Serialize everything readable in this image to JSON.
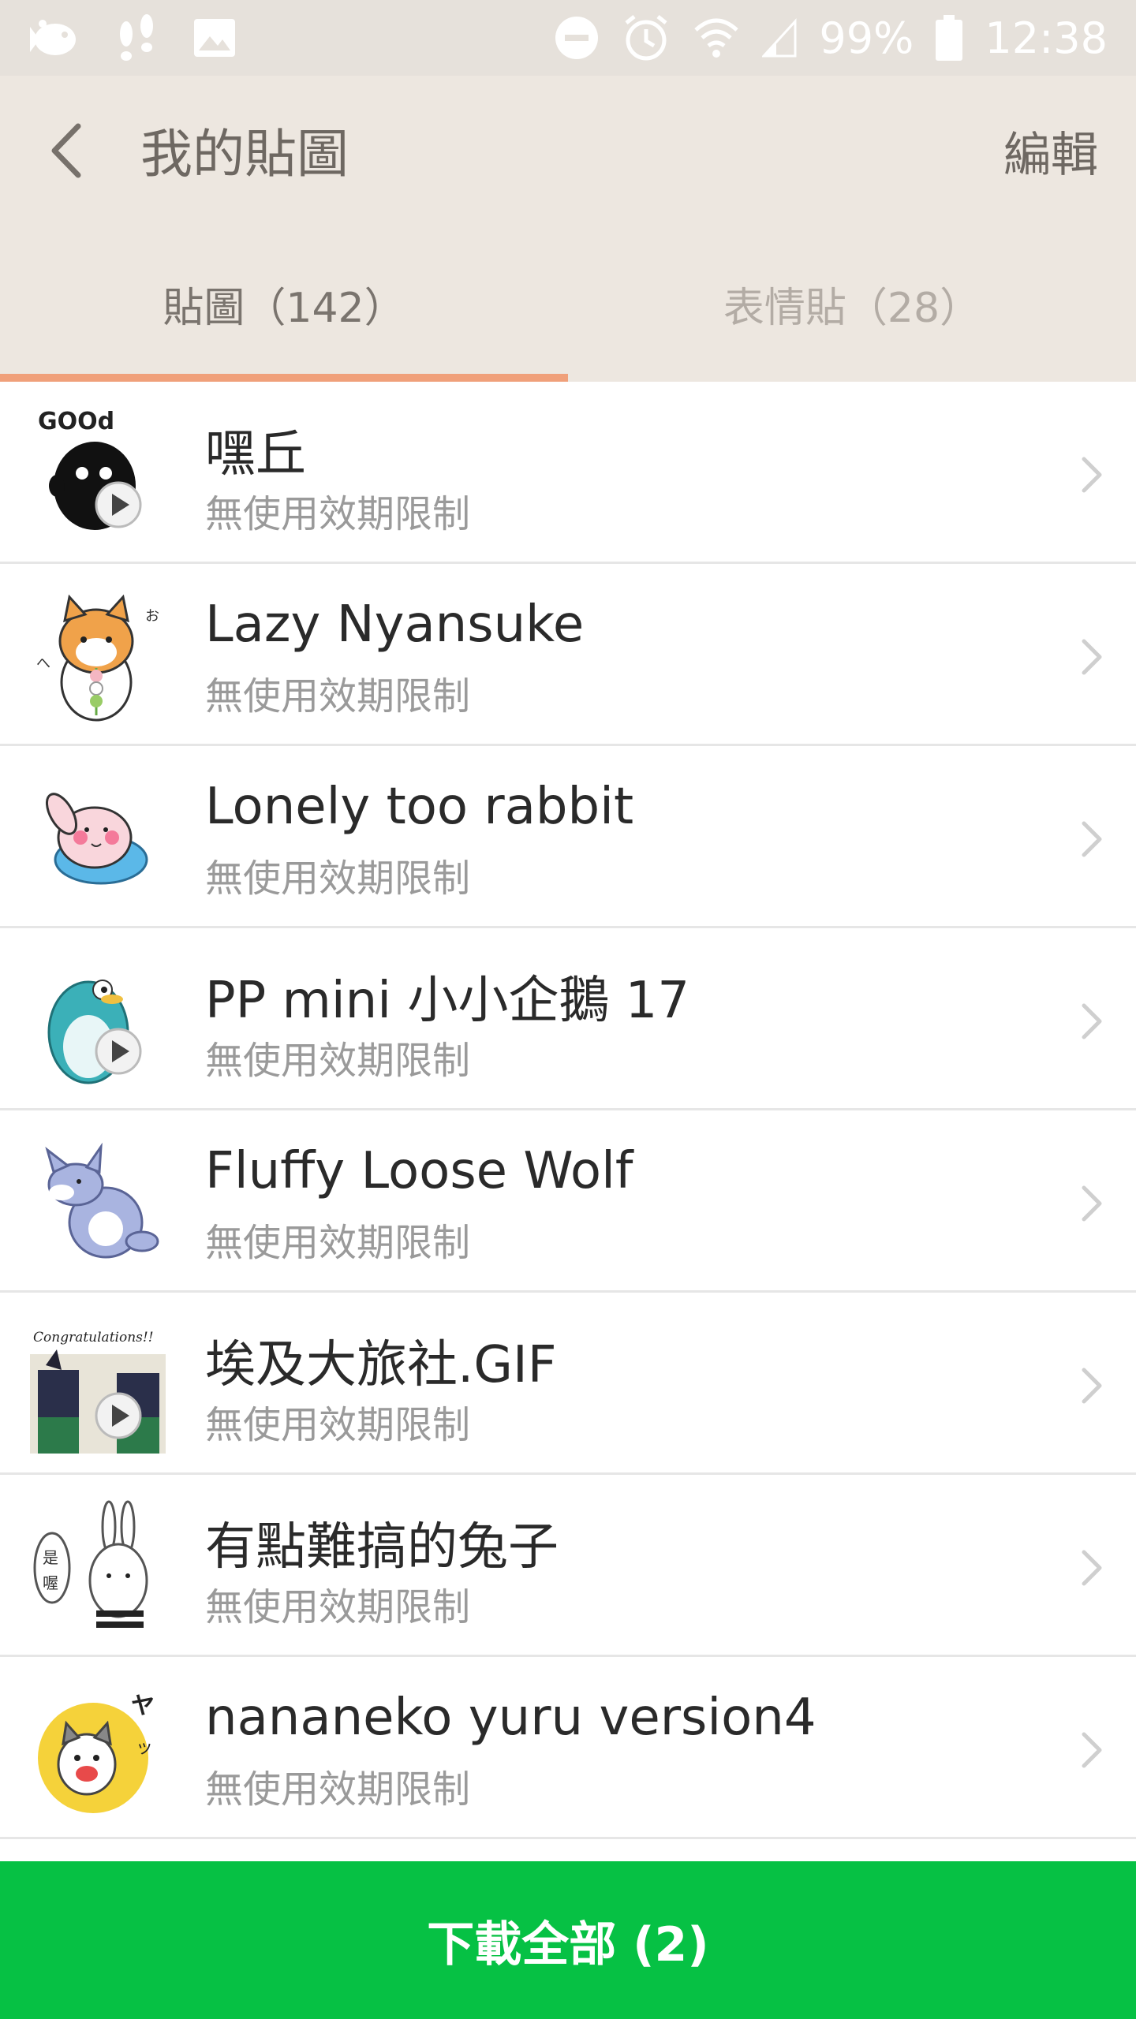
{
  "status_bar": {
    "battery_percent": "99%",
    "time": "12:38",
    "icons": [
      "fish-notification-icon",
      "footprints-icon",
      "image-icon",
      "do-not-disturb-icon",
      "alarm-icon",
      "wifi-icon",
      "signal-icon",
      "battery-icon"
    ]
  },
  "header": {
    "title": "我的貼圖",
    "edit_label": "編輯"
  },
  "tabs": [
    {
      "label": "貼圖（142）",
      "active": true
    },
    {
      "label": "表情貼（28）",
      "active": false
    }
  ],
  "stickers": [
    {
      "title": "嘿丘",
      "subtitle": "無使用效期限制",
      "animated": true,
      "thumb": "black-blob-good-sticker"
    },
    {
      "title": "Lazy Nyansuke",
      "subtitle": "無使用效期限制",
      "animated": false,
      "thumb": "cat-dango-sticker"
    },
    {
      "title": "Lonely too rabbit",
      "subtitle": "無使用效期限制",
      "animated": false,
      "thumb": "pink-rabbit-sticker"
    },
    {
      "title": "PP mini 小小企鵝 17",
      "subtitle": "無使用效期限制",
      "animated": true,
      "thumb": "teal-penguin-sticker"
    },
    {
      "title": "Fluffy Loose Wolf",
      "subtitle": "無使用效期限制",
      "animated": false,
      "thumb": "fluffy-wolf-sticker"
    },
    {
      "title": "埃及大旅社.GIF",
      "subtitle": "無使用效期限制",
      "animated": true,
      "thumb": "egypt-anubis-sticker"
    },
    {
      "title": "有點難搞的兔子",
      "subtitle": "無使用效期限制",
      "animated": false,
      "thumb": "white-bunny-sticker"
    },
    {
      "title": "nananeko yuru version4",
      "subtitle": "無使用效期限制",
      "animated": false,
      "thumb": "yellow-cat-sticker"
    }
  ],
  "thumb_text": {
    "good": "GOOd",
    "congrats": "Congratulations!!"
  },
  "download_all_label": "下載全部 (2)",
  "colors": {
    "header_bg": "#ede7e0",
    "tab_indicator": "#f0a07a",
    "download_green": "#06c144"
  }
}
